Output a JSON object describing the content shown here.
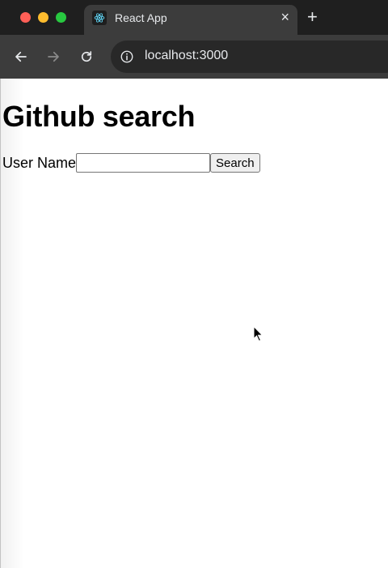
{
  "browser": {
    "tab_title": "React App",
    "tab_close": "×",
    "new_tab": "+",
    "url": "localhost:3000"
  },
  "icons": {
    "tab_favicon": "react-logo-icon",
    "back": "arrow-left-icon",
    "forward": "arrow-right-icon",
    "reload": "reload-icon",
    "site_info": "info-icon",
    "cursor": "mouse-pointer-icon"
  },
  "colors": {
    "chrome_bg": "#1f1f1f",
    "toolbar_bg": "#3c3c3c",
    "react_cyan": "#61dafb",
    "close_red": "#ff5f57",
    "minimize_yellow": "#febc2e",
    "zoom_green": "#28c840"
  },
  "page": {
    "title": "Github search",
    "form": {
      "label": "User Name",
      "input_value": "",
      "button_label": "Search"
    }
  }
}
